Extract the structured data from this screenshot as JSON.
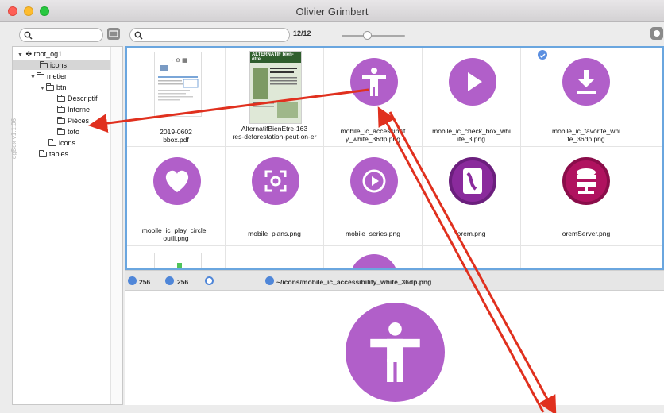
{
  "window": {
    "title": "Olivier Grimbert",
    "version": "ogBox v1.1.06"
  },
  "toolbar": {
    "count": "12/12",
    "left_search_placeholder": "",
    "main_search_placeholder": ""
  },
  "sidebar": {
    "items": [
      {
        "label": "root_og1"
      },
      {
        "label": "icons"
      },
      {
        "label": "metier"
      },
      {
        "label": "btn"
      },
      {
        "label": "Descriptif"
      },
      {
        "label": "Interne"
      },
      {
        "label": "Pièces"
      },
      {
        "label": "toto"
      },
      {
        "label": "icons"
      },
      {
        "label": "tables"
      }
    ]
  },
  "grid": {
    "items": [
      {
        "caption": "2019-0602 bbox.pdf"
      },
      {
        "caption": "AlternatifBienEtre-163 res-deforestation-peut-on-er",
        "thumb_title": "ALTERNATIF bien-être"
      },
      {
        "caption": "mobile_ic_accessibilit y_white_36dp.png"
      },
      {
        "caption": "mobile_ic_check_box_whi ite_3.png"
      },
      {
        "caption": "mobile_ic_favorite_whi te_36dp.png"
      },
      {
        "caption": "mobile_ic_play_circle_ outli.png"
      },
      {
        "caption": "mobile_plans.png"
      },
      {
        "caption": "mobile_series.png"
      },
      {
        "caption": "orem.png"
      },
      {
        "caption": "oremServer.png"
      }
    ]
  },
  "status": {
    "width": "256",
    "height": "256",
    "path": "~/icons/mobile_ic_accessibility_white_36dp.png"
  },
  "colors": {
    "accent_purple": "#b15fc9",
    "selection_blue": "#6aa6df",
    "arrow_red": "#e0301e"
  }
}
